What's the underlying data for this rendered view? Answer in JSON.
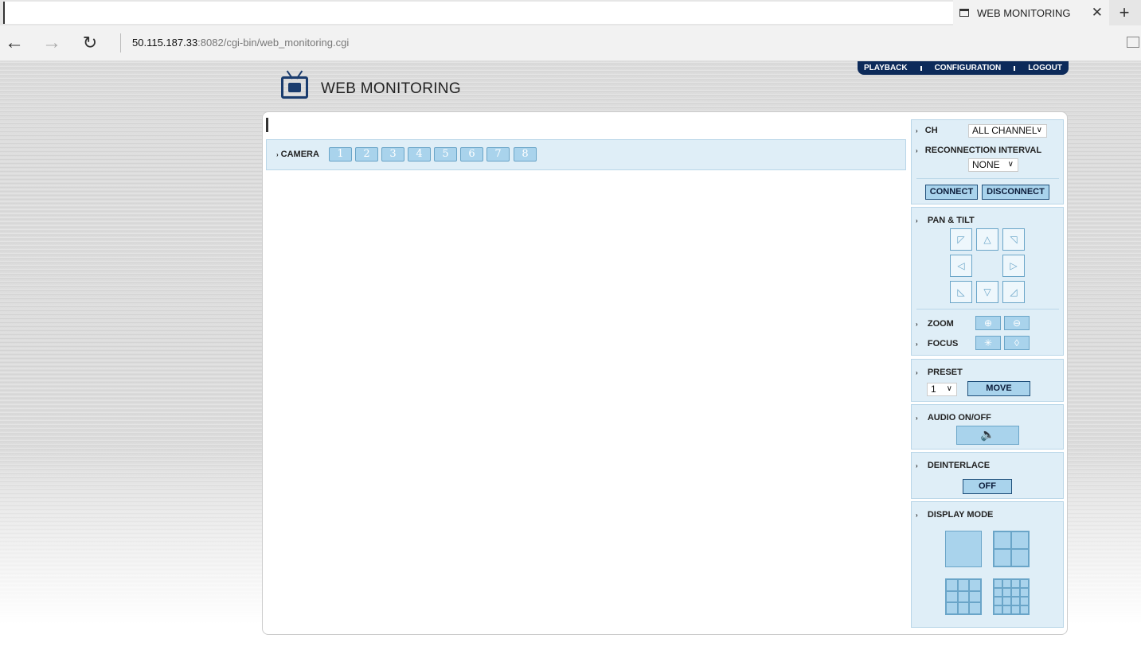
{
  "browser": {
    "tab_title": "WEB MONITORING",
    "url_host": "50.115.187.33",
    "url_rest": ":8082/cgi-bin/web_monitoring.cgi"
  },
  "topnav": {
    "playback": "PLAYBACK",
    "configuration": "CONFIGURATION",
    "logout": "LOGOUT"
  },
  "logo": {
    "title": "WEB MONITORING"
  },
  "camera": {
    "label": "CAMERA",
    "buttons": [
      "1",
      "2",
      "3",
      "4",
      "5",
      "6",
      "7",
      "8"
    ]
  },
  "side": {
    "ch_label": "CH",
    "ch_value": "ALL CHANNEL",
    "reconnect_label": "RECONNECTION INTERVAL",
    "reconnect_value": "NONE",
    "connect": "CONNECT",
    "disconnect": "DISCONNECT",
    "pan_tilt": "PAN & TILT",
    "zoom": "ZOOM",
    "focus": "FOCUS",
    "preset": "PRESET",
    "preset_value": "1",
    "move": "MOVE",
    "audio": "AUDIO ON/OFF",
    "deinterlace": "DEINTERLACE",
    "deinterlace_value": "OFF",
    "display_mode": "DISPLAY MODE"
  },
  "colors": {
    "nav_bg": "#0c2a5a",
    "panel_bg": "#dfeef7",
    "button_bg": "#a9d3ec",
    "button_border": "#6aa5c8"
  }
}
